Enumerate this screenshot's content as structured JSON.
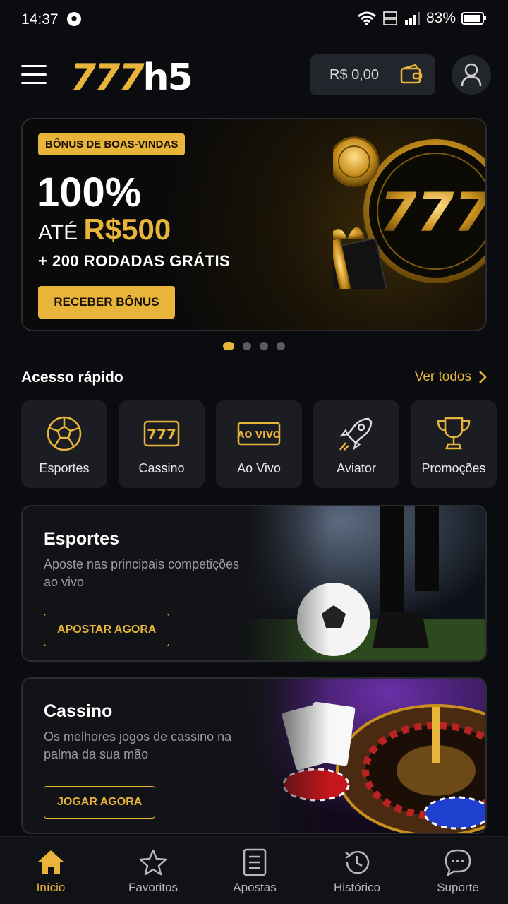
{
  "status_bar": {
    "time": "14:37",
    "battery": "83%"
  },
  "header": {
    "logo_num": "777",
    "logo_text": "h5",
    "balance": "R$ 0,00"
  },
  "banner": {
    "badge": "BÔNUS DE BOAS-VINDAS",
    "headline": "100%",
    "up_to": "ATÉ",
    "amount": "R$500",
    "extra": "+ 200 RODADAS GRÁTIS",
    "cta": "RECEBER BÔNUS",
    "art_text": "777",
    "slides": 4,
    "active_slide": 1
  },
  "quick_access": {
    "title": "Acesso rápido",
    "more": "Ver todos",
    "items": [
      {
        "label": "Esportes",
        "icon": "soccer-ball-icon"
      },
      {
        "label": "Cassino",
        "icon": "slot-777-icon",
        "icon_text": "777"
      },
      {
        "label": "Ao Vivo",
        "icon": "live-icon",
        "icon_text": "AO VIVO"
      },
      {
        "label": "Aviator",
        "icon": "rocket-icon"
      },
      {
        "label": "Promoções",
        "icon": "trophy-icon"
      }
    ]
  },
  "cards": [
    {
      "title": "Esportes",
      "desc": "Aposte nas principais competições ao vivo",
      "button": "APOSTAR AGORA"
    },
    {
      "title": "Cassino",
      "desc": "Os melhores jogos de cassino na palma da sua mão",
      "button": "JOGAR AGORA"
    }
  ],
  "bottom_nav": [
    {
      "label": "Início",
      "icon": "home-icon",
      "active": true
    },
    {
      "label": "Favoritos",
      "icon": "star-icon",
      "active": false
    },
    {
      "label": "Apostas",
      "icon": "ticket-icon",
      "active": false
    },
    {
      "label": "Histórico",
      "icon": "history-icon",
      "active": false
    },
    {
      "label": "Suporte",
      "icon": "chat-icon",
      "active": false
    }
  ],
  "colors": {
    "accent": "#e8b53a",
    "background": "#0b0c0f",
    "tile": "#1c1d22"
  }
}
